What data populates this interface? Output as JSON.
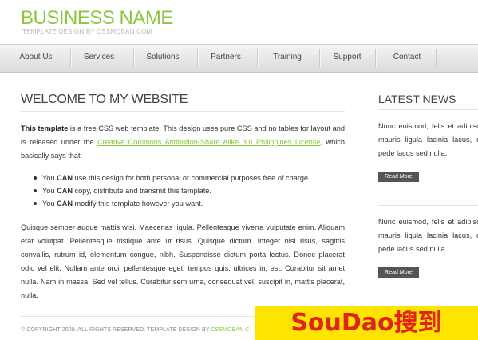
{
  "header": {
    "brand_name": "BUSINESS NAME",
    "brand_tagline": "TEMPLATE DESIGN BY CSSMOBAN.COM"
  },
  "nav": {
    "items": [
      "About Us",
      "Services",
      "Solutions",
      "Partners",
      "Training",
      "Support",
      "Contact"
    ]
  },
  "main": {
    "title": "WELCOME TO MY WEBSITE",
    "intro_bold": "This template",
    "intro_text_1": " is a free CSS web template. This design uses pure CSS and no tables for layout and is released under the ",
    "intro_link": "Creative Commons Attribution-Share Alike 3.0 Philippines License",
    "intro_text_2": ", which basically says that:",
    "bullets": [
      {
        "pre": "You ",
        "bold": "CAN",
        "post": " use this design for both personal or commercial purposes free of charge."
      },
      {
        "pre": "You ",
        "bold": "CAN",
        "post": " copy, distribute and transmit this template."
      },
      {
        "pre": "You ",
        "bold": "CAN",
        "post": " modify this template however you want."
      }
    ],
    "paragraph": "Quisque semper augue mattis wisi. Maecenas ligula. Pellentesque viverra vulputate enim. Aliquam erat volutpat. Pellentesque tristique ante ut risus. Quisque dictum. Integer nisl risus, sagittis convallis, rutrum id, elementum congue, nibh. Suspendisse dictum porta lectus. Donec placerat odio vel elit. Nullam ante orci, pellentesque eget, tempus quis, ultrices in, est. Curabitur sit amet nulla. Nam in massa. Sed vel tellus. Curabitur sem urna, consequat vel, suscipit in, mattis placerat, nulla."
  },
  "sidebar": {
    "title": "LATEST NEWS",
    "news": [
      {
        "text": "Nunc euismod, felis et adipiscing mauris ligula lacinia lacus, quis pede lacus sed nulla.",
        "button": "Read More"
      },
      {
        "text": "Nunc euismod, felis et adipiscing mauris ligula lacinia lacus, quis pede lacus sed nulla.",
        "button": "Read More"
      }
    ]
  },
  "footer": {
    "copyright": "© COPYRIGHT 2009. ALL RIGHTS RESERVED. TEMPLATE DESIGN BY ",
    "link": "CSSMOBAN.C"
  },
  "watermark": {
    "text": "SouDao搜到"
  },
  "colors": {
    "accent": "#8cc63f",
    "watermark_bg": "#ffe400",
    "watermark_text": "#e2231a"
  }
}
